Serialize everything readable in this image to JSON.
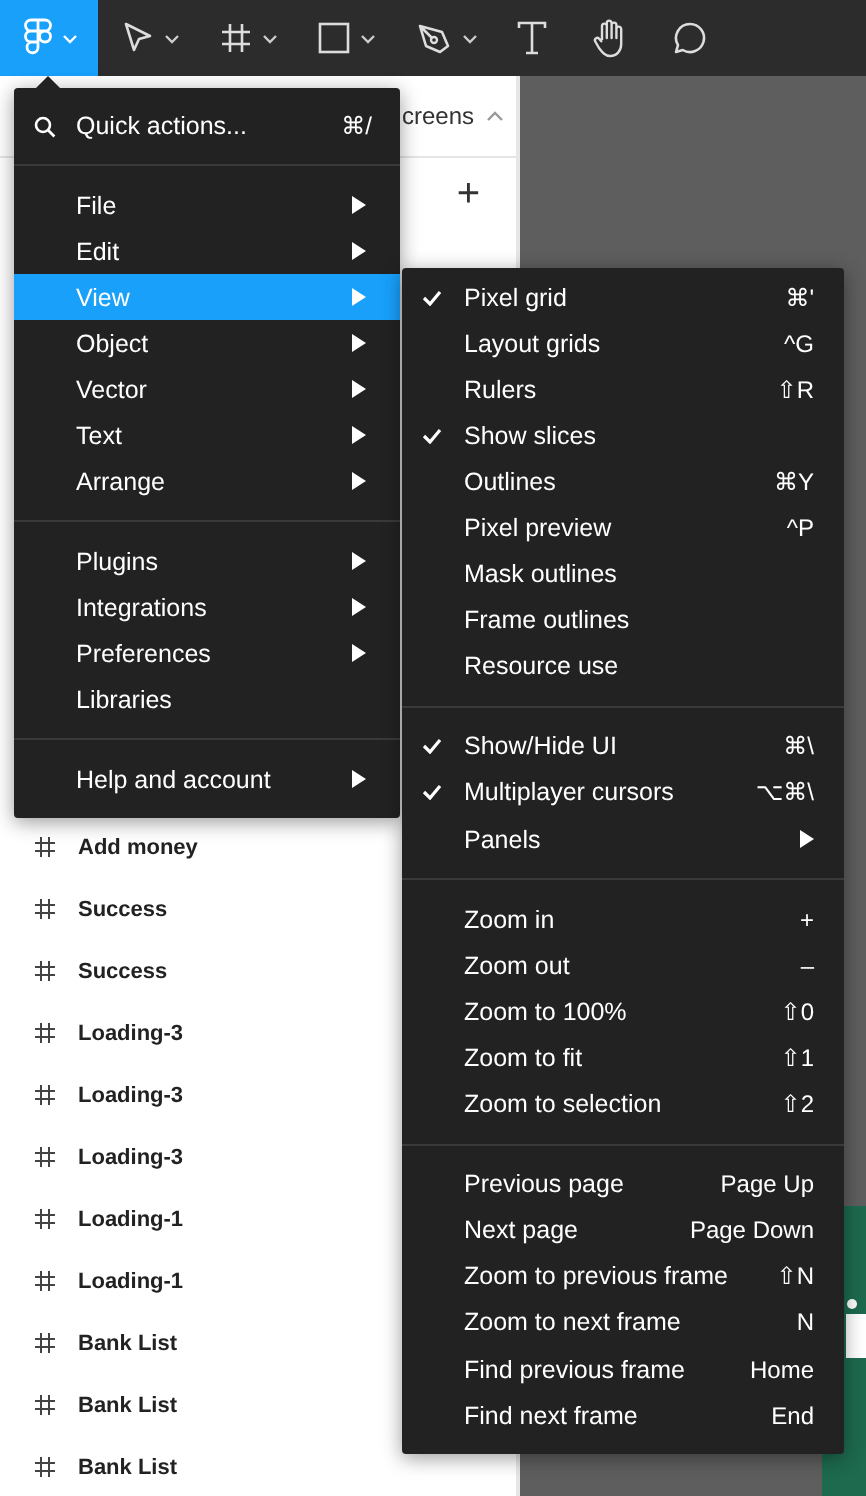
{
  "toolbar": {
    "tools": [
      {
        "kind": "logo",
        "selected": true,
        "dropdown": true
      },
      {
        "kind": "move",
        "selected": false,
        "dropdown": true
      },
      {
        "kind": "frame",
        "selected": false,
        "dropdown": true
      },
      {
        "kind": "shape",
        "selected": false,
        "dropdown": true
      },
      {
        "kind": "pen",
        "selected": false,
        "dropdown": true
      },
      {
        "kind": "text",
        "selected": false,
        "dropdown": false
      },
      {
        "kind": "hand",
        "selected": false,
        "dropdown": false
      },
      {
        "kind": "comment",
        "selected": false,
        "dropdown": false
      }
    ]
  },
  "layers_panel": {
    "header": "creens",
    "add_button": "+",
    "items": [
      "Add money",
      "Success",
      "Success",
      "Loading-3",
      "Loading-3",
      "Loading-3",
      "Loading-1",
      "Loading-1",
      "Bank List",
      "Bank List",
      "Bank List"
    ]
  },
  "main_menu": {
    "search": {
      "label": "Quick actions...",
      "shortcut": "⌘/"
    },
    "groups": [
      {
        "items": [
          {
            "label": "File",
            "submenu": true,
            "selected": false
          },
          {
            "label": "Edit",
            "submenu": true,
            "selected": false
          },
          {
            "label": "View",
            "submenu": true,
            "selected": true
          },
          {
            "label": "Object",
            "submenu": true,
            "selected": false
          },
          {
            "label": "Vector",
            "submenu": true,
            "selected": false
          },
          {
            "label": "Text",
            "submenu": true,
            "selected": false
          },
          {
            "label": "Arrange",
            "submenu": true,
            "selected": false
          }
        ]
      },
      {
        "items": [
          {
            "label": "Plugins",
            "submenu": true,
            "selected": false
          },
          {
            "label": "Integrations",
            "submenu": true,
            "selected": false
          },
          {
            "label": "Preferences",
            "submenu": true,
            "selected": false
          },
          {
            "label": "Libraries",
            "submenu": false,
            "selected": false
          }
        ]
      },
      {
        "items": [
          {
            "label": "Help and account",
            "submenu": true,
            "selected": false
          }
        ]
      }
    ]
  },
  "view_submenu": {
    "groups": [
      {
        "items": [
          {
            "label": "Pixel grid",
            "checked": true,
            "shortcut": "⌘'",
            "submenu": false
          },
          {
            "label": "Layout grids",
            "checked": false,
            "shortcut": "^G",
            "submenu": false
          },
          {
            "label": "Rulers",
            "checked": false,
            "shortcut": "⇧R",
            "submenu": false
          },
          {
            "label": "Show slices",
            "checked": true,
            "submenu": false
          },
          {
            "label": "Outlines",
            "checked": false,
            "shortcut": "⌘Y",
            "submenu": false
          },
          {
            "label": "Pixel preview",
            "checked": false,
            "shortcut": "^P",
            "submenu": false
          },
          {
            "label": "Mask outlines",
            "checked": false,
            "submenu": false
          },
          {
            "label": "Frame outlines",
            "checked": false,
            "submenu": false
          },
          {
            "label": "Resource use",
            "checked": false,
            "submenu": false
          }
        ]
      },
      {
        "items": [
          {
            "label": "Show/Hide UI",
            "checked": true,
            "shortcut": "⌘\\",
            "submenu": false
          },
          {
            "label": "Multiplayer cursors",
            "checked": true,
            "shortcut": "⌥⌘\\",
            "submenu": false
          },
          {
            "label": "Panels",
            "checked": false,
            "submenu": true
          }
        ]
      },
      {
        "items": [
          {
            "label": "Zoom in",
            "checked": false,
            "shortcut": "+",
            "submenu": false
          },
          {
            "label": "Zoom out",
            "checked": false,
            "shortcut": "–",
            "submenu": false
          },
          {
            "label": "Zoom to 100%",
            "checked": false,
            "shortcut": "⇧0",
            "submenu": false
          },
          {
            "label": "Zoom to fit",
            "checked": false,
            "shortcut": "⇧1",
            "submenu": false
          },
          {
            "label": "Zoom to selection",
            "checked": false,
            "shortcut": "⇧2",
            "submenu": false
          }
        ]
      },
      {
        "items": [
          {
            "label": "Previous page",
            "checked": false,
            "shortcut": "Page Up",
            "submenu": false
          },
          {
            "label": "Next page",
            "checked": false,
            "shortcut": "Page Down",
            "submenu": false
          },
          {
            "label": "Zoom to previous frame",
            "checked": false,
            "shortcut": "⇧N",
            "submenu": false
          },
          {
            "label": "Zoom to next frame",
            "checked": false,
            "shortcut": "N",
            "submenu": false
          },
          {
            "label": "Find previous frame",
            "checked": false,
            "shortcut": "Home",
            "submenu": false
          },
          {
            "label": "Find next frame",
            "checked": false,
            "shortcut": "End",
            "submenu": false
          }
        ]
      }
    ]
  }
}
